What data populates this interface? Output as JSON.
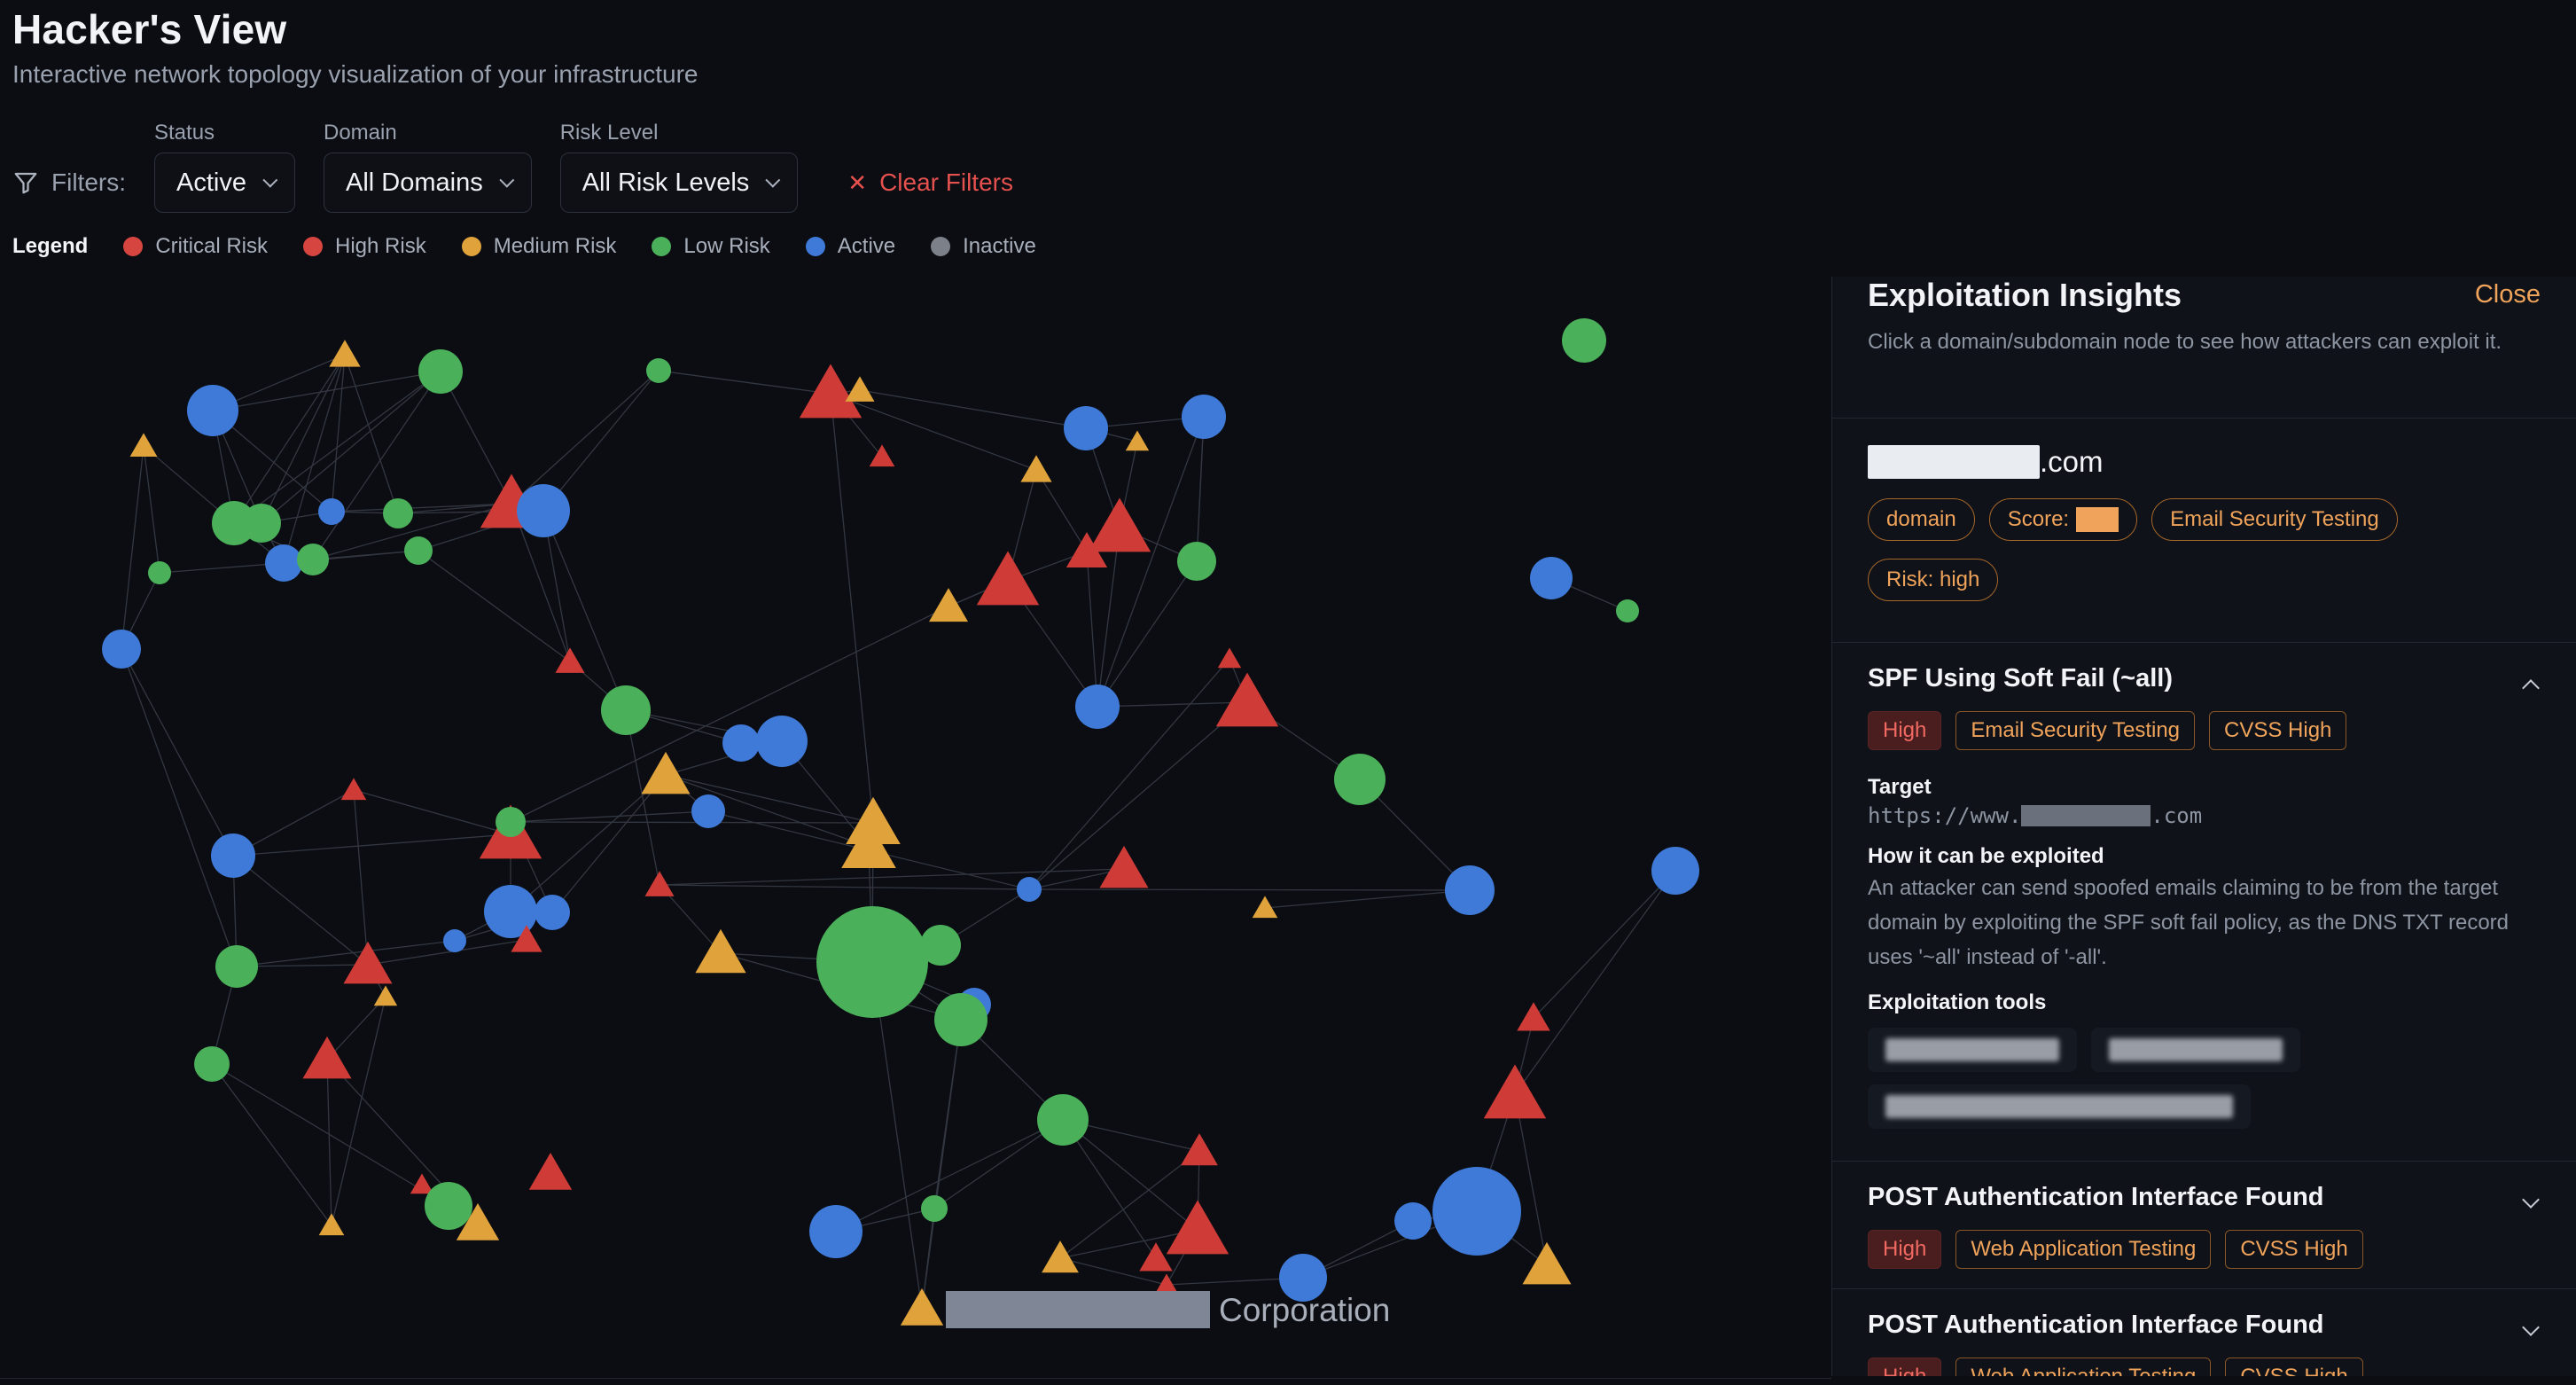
{
  "header": {
    "title": "Hacker's View",
    "subtitle": "Interactive network topology visualization of your infrastructure"
  },
  "filters": {
    "label": "Filters:",
    "status": {
      "label": "Status",
      "value": "Active"
    },
    "domain": {
      "label": "Domain",
      "value": "All Domains"
    },
    "risk": {
      "label": "Risk Level",
      "value": "All Risk Levels"
    },
    "clear_label": "Clear Filters"
  },
  "legend": {
    "title": "Legend",
    "items": [
      {
        "label": "Critical Risk",
        "color": "#d64540"
      },
      {
        "label": "High Risk",
        "color": "#d64540"
      },
      {
        "label": "Medium Risk",
        "color": "#e0a33c"
      },
      {
        "label": "Low Risk",
        "color": "#4bb05a"
      },
      {
        "label": "Active",
        "color": "#3f7ad8"
      },
      {
        "label": "Inactive",
        "color": "#7c8088"
      }
    ]
  },
  "graph": {
    "root_label_suffix": "Corporation",
    "colors": {
      "high": "#cf3b37",
      "medium": "#e0a33c",
      "low": "#4bb05a",
      "active": "#3f7ad8",
      "edge": "#3a3f4a"
    }
  },
  "panel": {
    "title": "Exploitation Insights",
    "close_label": "Close",
    "description": "Click a domain/subdomain node to see how attackers can exploit it.",
    "domain": {
      "suffix": ".com",
      "tags": {
        "type": "domain",
        "score_label": "Score:",
        "category": "Email Security Testing",
        "risk": "Risk: high"
      }
    },
    "vulns": [
      {
        "title": "SPF Using Soft Fail (~all)",
        "severity": "High",
        "category": "Email Security Testing",
        "cvss": "CVSS High",
        "target_label": "Target",
        "target_prefix": "https://www.",
        "target_suffix": ".com",
        "exploit_label": "How it can be exploited",
        "exploit_text": "An attacker can send spoofed emails claiming to be from the target domain by exploiting the SPF soft fail policy, as the DNS TXT record uses '~all' instead of '-all'.",
        "tools_label": "Exploitation tools"
      },
      {
        "title": "POST Authentication Interface Found",
        "severity": "High",
        "category": "Web Application Testing",
        "cvss": "CVSS High"
      },
      {
        "title": "POST Authentication Interface Found",
        "severity": "High",
        "category": "Web Application Testing",
        "cvss": "CVSS High"
      }
    ]
  }
}
